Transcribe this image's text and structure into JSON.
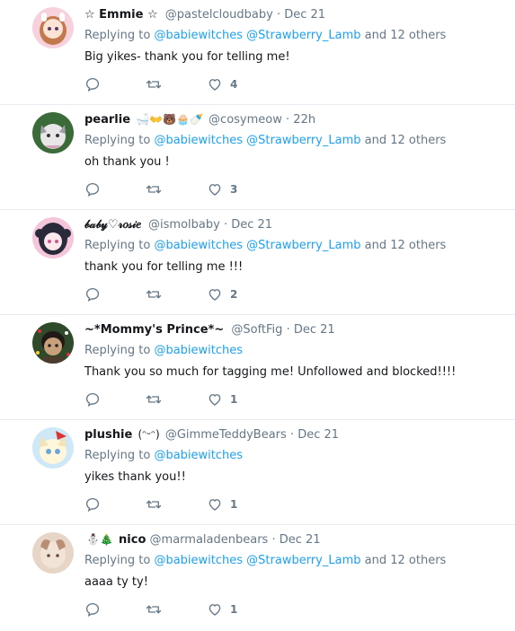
{
  "tweets": [
    {
      "name": "☆ Emmie ☆",
      "emojis": "",
      "handle": "@pastelcloudbaby",
      "time": "Dec 21",
      "reply_prefix": "Replying to",
      "mention1": "@babiewitches",
      "mention2": "@Strawberry_Lamb",
      "reply_suffix": "and 12 others",
      "text": "Big yikes- thank you for telling me!",
      "likes": "4",
      "avatar": {
        "bg": "#f7d1dc",
        "fg": "#c27a4d",
        "face": "#fbe3d6"
      }
    },
    {
      "name": "pearlie",
      "emojis": "🛁👐🐻🧁🍼",
      "handle": "@cosymeow",
      "time": "22h",
      "reply_prefix": "Replying to",
      "mention1": "@babiewitches",
      "mention2": "@Strawberry_Lamb",
      "reply_suffix": "and 12 others",
      "text": "oh thank you !",
      "likes": "3",
      "avatar": {
        "bg": "#3c6b3a",
        "fg": "#9aa0a6",
        "face": "#e8e6e6"
      }
    },
    {
      "name": "𝒷𝒶𝒷𝓎♡𝓇𝑜𝓈𝒾𝑒",
      "emojis": "",
      "handle": "@ismolbaby",
      "time": "Dec 21",
      "reply_prefix": "Replying to",
      "mention1": "@babiewitches",
      "mention2": "@Strawberry_Lamb",
      "reply_suffix": "and 12 others",
      "text": "thank you for telling me !!!",
      "likes": "2",
      "avatar": {
        "bg": "#f5c6d9",
        "fg": "#2a2a3a",
        "face": "#fde8ee"
      }
    },
    {
      "name": "~*Mommy's Prince*~",
      "emojis": "",
      "handle": "@SoftFig",
      "time": "Dec 21",
      "reply_prefix": "Replying to",
      "mention1": "@babiewitches",
      "mention2": "",
      "reply_suffix": "",
      "text": "Thank you so much for tagging me! Unfollowed and blocked!!!!",
      "likes": "1",
      "avatar": {
        "bg": "#2f4a2a",
        "fg": "#1f1a17",
        "face": "#c9a07c"
      }
    },
    {
      "name": "plushie",
      "emojis": "(ᵔᵕᵔ)",
      "handle": "@GimmeTeddyBears",
      "time": "Dec 21",
      "reply_prefix": "Replying to",
      "mention1": "@babiewitches",
      "mention2": "",
      "reply_suffix": "",
      "text": "yikes thank you!!",
      "likes": "1",
      "avatar": {
        "bg": "#cfe8f7",
        "fg": "#f3e3b5",
        "face": "#fff6dc"
      }
    },
    {
      "name": "nico",
      "emojis": "⛄🎄",
      "handle": "@marmaladenbears",
      "time": "Dec 21",
      "reply_prefix": "Replying to",
      "mention1": "@babiewitches",
      "mention2": "@Strawberry_Lamb",
      "reply_suffix": "and 12 others",
      "text": "aaaa ty ty!",
      "likes": "1",
      "avatar": {
        "bg": "#e7d6c8",
        "fg": "#b98e76",
        "face": "#f1e3d6"
      }
    }
  ],
  "separator": "·",
  "colors": {
    "link": "#1da1f2",
    "muted": "#657786",
    "border": "#e6ecf0"
  }
}
